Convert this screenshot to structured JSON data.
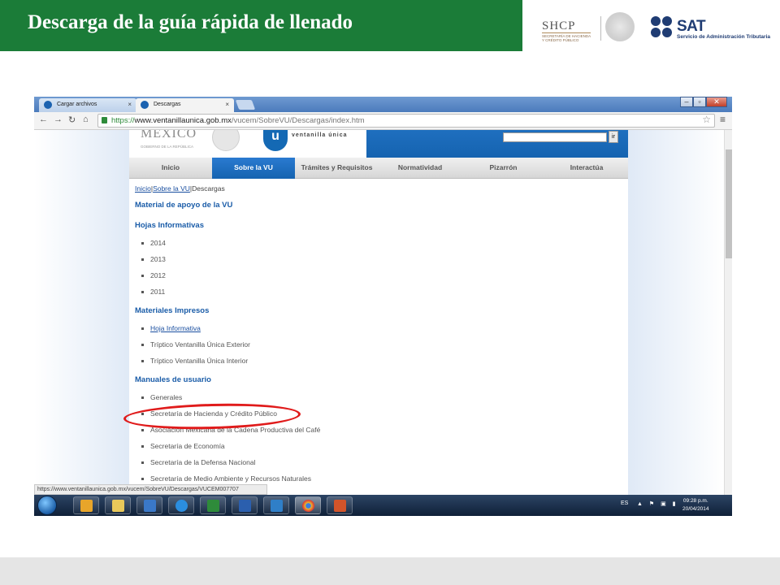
{
  "slide": {
    "title": "Descarga de la guía rápida de llenado",
    "shcp_logo": "SHCP",
    "shcp_sub": "SECRETARÍA DE HACIENDA Y CRÉDITO PÚBLICO",
    "sat_logo": "SAT",
    "sat_sub": "Servicio de Administración Tributaria",
    "header_color": "#1b7c38"
  },
  "browser": {
    "tabs": [
      {
        "label": "Cargar archivos",
        "active": false
      },
      {
        "label": "Descargas",
        "active": true
      }
    ],
    "close_glyph": "×",
    "url_scheme": "https://",
    "url_host": "www.ventanillaunica.gob.mx",
    "url_path": "/vucem/SobreVU/Descargas/index.htm",
    "status_url": "https://www.ventanillaunica.gob.mx/vucem/SobreVU/Descargas/VUCEM007707"
  },
  "site": {
    "brand_country": "MÉXICO",
    "brand_gob": "GOBIERNO DE LA REPÚBLICA",
    "vu_logo_letter": "u",
    "vu_name": "ventanilla única",
    "search_go": "ir",
    "nav": [
      {
        "label": "Inicio",
        "active": false
      },
      {
        "label": "Sobre la VU",
        "active": true
      },
      {
        "label": "Trámites y Requisitos",
        "active": false
      },
      {
        "label": "Normatividad",
        "active": false
      },
      {
        "label": "Pizarrón",
        "active": false
      },
      {
        "label": "Interactúa",
        "active": false
      }
    ],
    "breadcrumb": {
      "home": "Inicio",
      "section": "Sobre la VU",
      "current": "Descargas",
      "sep": "|"
    },
    "heading_main": "Material de apoyo de la VU",
    "sections": [
      {
        "title": "Hojas Informativas",
        "items": [
          "2014",
          "2013",
          "2012",
          "2011"
        ]
      },
      {
        "title": "Materiales Impresos",
        "items": [
          "Hoja Informativa",
          "Tríptico Ventanilla Única Exterior",
          "Tríptico Ventanilla Única Interior"
        ]
      },
      {
        "title": "Manuales de usuario",
        "items": [
          "Generales",
          "Secretaría de Hacienda y Crédito Público",
          "Asociación Mexicana de la Cadena Productiva del Café",
          "Secretaría de Economía",
          "Secretaría de la Defensa Nacional",
          "Secretaría de Medio Ambiente y Recursos Naturales"
        ]
      }
    ]
  },
  "taskbar": {
    "lang": "ES",
    "time": "09:28 p.m.",
    "date": "20/04/2014"
  },
  "annotation_color": "#e01b1b"
}
